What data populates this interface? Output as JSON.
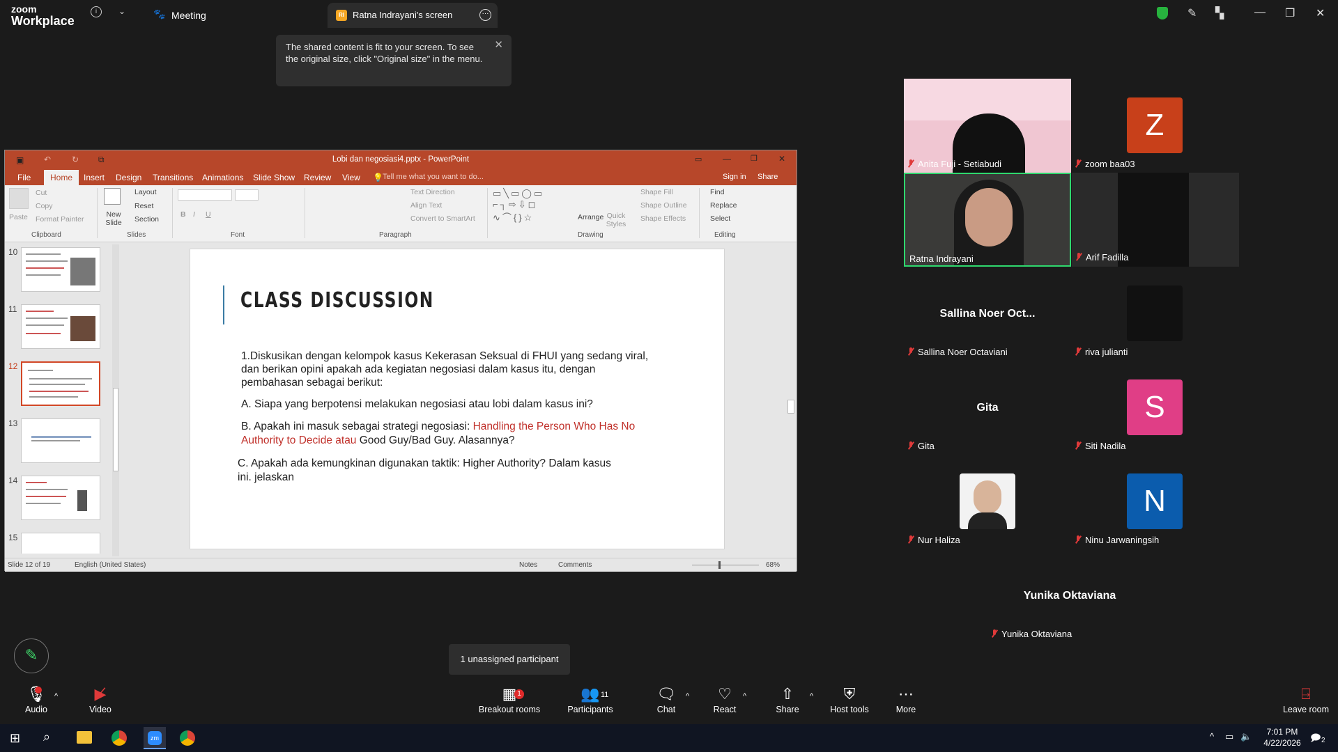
{
  "zoom": {
    "brand_top": "zoom",
    "brand_bottom": "Workplace",
    "meeting_label": "Meeting",
    "screen_tab": "Ratna Indrayani's screen",
    "screen_tab_initials": "RI"
  },
  "tooltip": {
    "text": "The shared content is fit to your screen. To see the original size, click \"Original size\" in the menu."
  },
  "ppt": {
    "title": "Lobi dan negosiasi4.pptx - PowerPoint",
    "tabs": [
      "File",
      "Home",
      "Insert",
      "Design",
      "Transitions",
      "Animations",
      "Slide Show",
      "Review",
      "View"
    ],
    "tell_me": "Tell me what you want to do...",
    "signin": "Sign in",
    "share": "Share",
    "clipboard": {
      "paste": "Paste",
      "cut": "Cut",
      "copy": "Copy",
      "format_painter": "Format Painter",
      "group": "Clipboard"
    },
    "slides": {
      "new_slide": "New Slide",
      "layout": "Layout",
      "reset": "Reset",
      "section": "Section",
      "group": "Slides"
    },
    "font_group": "Font",
    "paragraph": {
      "text_direction": "Text Direction",
      "align_text": "Align Text",
      "convert": "Convert to SmartArt",
      "group": "Paragraph"
    },
    "drawing": {
      "arrange": "Arrange",
      "quick_styles": "Quick Styles",
      "shape_fill": "Shape Fill",
      "shape_outline": "Shape Outline",
      "shape_effects": "Shape Effects",
      "group": "Drawing"
    },
    "editing": {
      "find": "Find",
      "replace": "Replace",
      "select": "Select",
      "group": "Editing"
    },
    "thumb_numbers": [
      "10",
      "11",
      "12",
      "13",
      "14",
      "15"
    ],
    "slide": {
      "title": "CLASS DISCUSSION",
      "p1": "1.Diskusikan dengan kelompok kasus Kekerasan Seksual di FHUI yang sedang viral,",
      "p1b": "dan berikan opini apakah ada kegiatan negosiasi dalam kasus itu, dengan",
      "p1c": "pembahasan sebagai berikut:",
      "pA": "A. Siapa yang berpotensi melakukan negosiasi atau lobi dalam kasus ini?",
      "pB1": "B. Apakah ini masuk sebagai strategi negosiasi: ",
      "pB_red1": "Handling the Person Who Has No",
      "pB_red2": "Authority to Decide atau",
      "pB_tail": " Good Guy/Bad Guy. Alasannya?",
      "pC1": "C. Apakah ada kemungkinan digunakan taktik: Higher Authority? Dalam kasus",
      "pC2": "ini. jelaskan"
    },
    "status": {
      "slide_of": "Slide 12 of 19",
      "language": "English (United States)",
      "notes": "Notes",
      "comments": "Comments",
      "zoom": "68%"
    }
  },
  "participants": [
    {
      "name": "Anita Fuji - Setiabudi"
    },
    {
      "name": "zoom baa03",
      "initial": "Z",
      "color": "#c8401a"
    },
    {
      "name": "Ratna Indrayani"
    },
    {
      "name": "Arif Fadilla"
    },
    {
      "name": "Sallina Noer Octaviani",
      "display": "Sallina Noer Oct..."
    },
    {
      "name": "riva julianti"
    },
    {
      "name": "Gita",
      "display": "Gita"
    },
    {
      "name": "Siti Nadila",
      "initial": "S",
      "color": "#e03e86"
    },
    {
      "name": "Nur Haliza"
    },
    {
      "name": "Ninu Jarwaningsih",
      "initial": "N",
      "color": "#0b5cad"
    },
    {
      "name": "Yunika Oktaviana",
      "display": "Yunika Oktaviana"
    }
  ],
  "unassigned": "1 unassigned participant",
  "controls": {
    "audio": "Audio",
    "video": "Video",
    "breakout": "Breakout rooms",
    "breakout_badge": "1",
    "participants": "Participants",
    "participants_count": "11",
    "chat": "Chat",
    "react": "React",
    "share": "Share",
    "host_tools": "Host tools",
    "more": "More",
    "leave": "Leave room"
  },
  "taskbar": {
    "time": "7:01 PM",
    "date": "4/22/2026",
    "notif_count": "2"
  }
}
